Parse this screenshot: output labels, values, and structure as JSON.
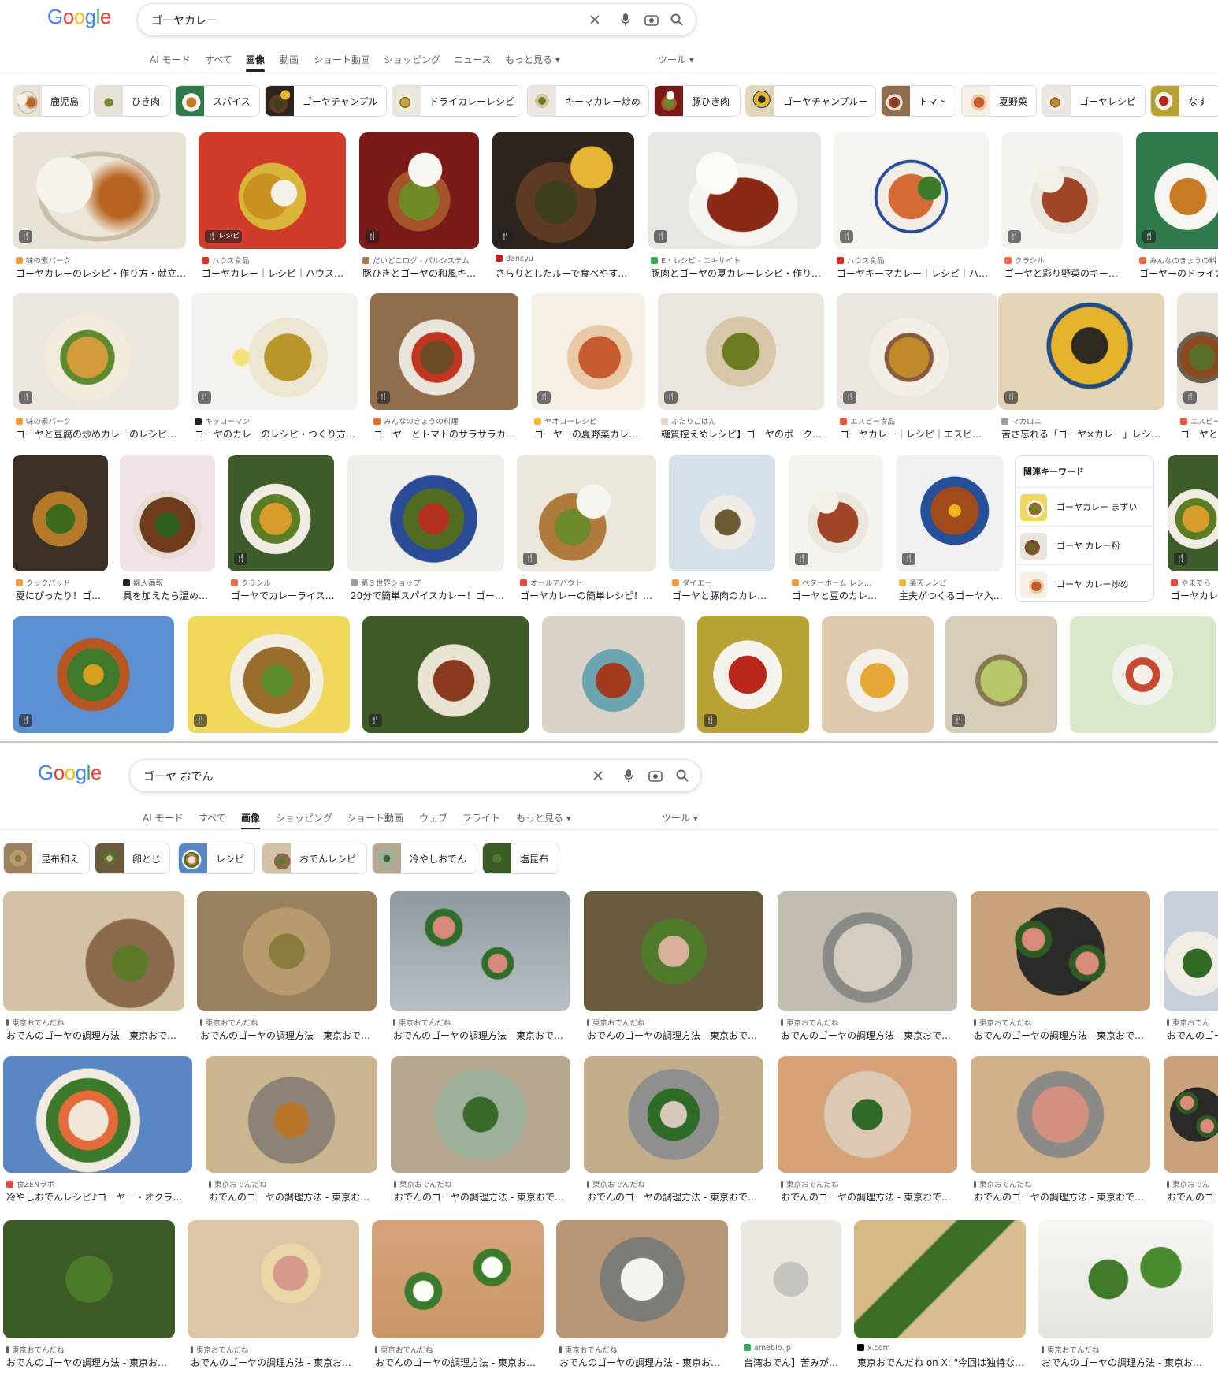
{
  "top": {
    "logo": "Google",
    "query": "ゴーヤカレー",
    "tabs": [
      "AI モード",
      "すべて",
      "画像",
      "動画",
      "ショート動画",
      "ショッピング",
      "ニュース",
      "もっと見る ▾"
    ],
    "active_tab": "画像",
    "tools": "ツール ▾",
    "chips": [
      "鹿児島",
      "ひき肉",
      "スパイス",
      "ゴーヤチャンプル",
      "ドライカレーレシピ",
      "キーマカレー炒め",
      "豚ひき肉",
      "ゴーヤチャンプルー",
      "トマト",
      "夏野菜",
      "ゴーヤレシピ",
      "なす"
    ],
    "row1": [
      {
        "source": "味の素パーク",
        "title": "ゴーヤカレーのレシピ・作り方・献立…",
        "badge": "🍴"
      },
      {
        "source": "ハウス食品",
        "title": "ゴーヤカレー｜レシピ｜ハウス…",
        "badge": "🍴 レシピ"
      },
      {
        "source": "だいどこログ - パルシステム",
        "title": "豚ひきとゴーヤの和風キ…",
        "badge": "🍴"
      },
      {
        "source": "dancyu",
        "title": "さらりとしたルーで食べやす…",
        "badge": "🍴"
      },
      {
        "source": "E・レシピ - エキサイト",
        "title": "豚肉とゴーヤの夏カレーレシピ・作り…",
        "badge": "🍴"
      },
      {
        "source": "ハウス食品",
        "title": "ゴーヤキーマカレー｜レシピ｜ハ…",
        "badge": "🍴"
      },
      {
        "source": "クラシル",
        "title": "ゴーヤと彩り野菜のキー…",
        "badge": "🍴"
      },
      {
        "source": "みんなのきょうの料",
        "title": "ゴーヤーのドライカ",
        "badge": "🍴"
      }
    ],
    "row2": [
      {
        "source": "味の素パーク",
        "title": "ゴーヤと豆腐の炒めカレーのレシピ…",
        "badge": "🍴"
      },
      {
        "source": "キッコーマン",
        "title": "ゴーヤのカレーのレシピ・つくり方…",
        "badge": "🍴"
      },
      {
        "source": "みんなのきょうの料理",
        "title": "ゴーヤーとトマトのサラサラカ…",
        "badge": "🍴"
      },
      {
        "source": "ヤオコーレシピ",
        "title": "ゴーヤーの夏野菜カレ…",
        "badge": "🍴"
      },
      {
        "source": "ふたりごはん",
        "title": "糖質控えめレシピ】ゴーヤのポーク…",
        "badge": "🍴"
      },
      {
        "source": "エスビー食品",
        "title": "ゴーヤカレー｜レシピ｜エスビ…",
        "badge": "🍴"
      },
      {
        "source": "マカロニ",
        "title": "苦さ忘れる「ゴーヤ×カレー」レシ…",
        "badge": "🍴"
      },
      {
        "source": "エスビー",
        "title": "ゴーヤと",
        "badge": "🍴"
      }
    ],
    "row3": [
      {
        "source": "クックパッド",
        "title": "夏にぴったり！ゴ…",
        "badge": ""
      },
      {
        "source": "婦人画報",
        "title": "具を加えたら温め…",
        "badge": ""
      },
      {
        "source": "クラシル",
        "title": "ゴーヤでカレーライス…",
        "badge": "🍴"
      },
      {
        "source": "第３世界ショップ",
        "title": "20分で簡単スパイスカレー！ゴー…",
        "badge": ""
      },
      {
        "source": "オールアバウト",
        "title": "ゴーヤカレーの簡単レシピ！…",
        "badge": "🍴"
      },
      {
        "source": "ダイエー",
        "title": "ゴーヤと豚肉のカレ…",
        "badge": ""
      },
      {
        "source": "ベターホーム レシ…",
        "title": "ゴーヤと豆のカレ…",
        "badge": "🍴"
      },
      {
        "source": "楽天レシピ",
        "title": "主夫がつくるゴーヤ入…",
        "badge": "🍴"
      },
      {
        "source": "やまでら",
        "title": "ゴーヤカレ",
        "badge": "🍴"
      }
    ],
    "related": {
      "header": "関連キーワード",
      "items": [
        "ゴーヤカレー まずい",
        "ゴーヤ カレー粉",
        "ゴーヤ カレー炒め"
      ]
    },
    "row4_badges": [
      "🍴",
      "🍴",
      "🍴",
      "",
      "🍴",
      "",
      "",
      "🍴",
      ""
    ]
  },
  "bottom": {
    "logo": "Google",
    "query": "ゴーヤ おでん",
    "tabs": [
      "AI モード",
      "すべて",
      "画像",
      "ショッピング",
      "ショート動画",
      "ウェブ",
      "フライト",
      "もっと見る ▾"
    ],
    "active_tab": "画像",
    "tools": "ツール ▾",
    "chips": [
      "昆布和え",
      "卵とじ",
      "レシピ",
      "おでんレシピ",
      "冷やしおでん",
      "塩昆布"
    ],
    "row1": [
      {
        "source": "東京おでんだね",
        "title": "おでんのゴーヤの調理方法 - 東京おで…"
      },
      {
        "source": "東京おでんだね",
        "title": "おでんのゴーヤの調理方法 - 東京おで…"
      },
      {
        "source": "東京おでんだね",
        "title": "おでんのゴーヤの調理方法 - 東京おで…"
      },
      {
        "source": "東京おでんだね",
        "title": "おでんのゴーヤの調理方法 - 東京おで…"
      },
      {
        "source": "東京おでんだね",
        "title": "おでんのゴーヤの調理方法 - 東京おで…"
      },
      {
        "source": "東京おでんだね",
        "title": "おでんのゴーヤの調理方法 - 東京おで…"
      },
      {
        "source": "東京おでん",
        "title": "おでんのゴー"
      }
    ],
    "row2": [
      {
        "source": "食ZENラボ",
        "title": "冷やしおでんレシピ♪ゴーヤー・オクラ…"
      },
      {
        "source": "東京おでんだね",
        "title": "おでんのゴーヤの調理方法 - 東京お…"
      },
      {
        "source": "東京おでんだね",
        "title": "おでんのゴーヤの調理方法 - 東京おで…"
      },
      {
        "source": "東京おでんだね",
        "title": "おでんのゴーヤの調理方法 - 東京おで…"
      },
      {
        "source": "東京おでんだね",
        "title": "おでんのゴーヤの調理方法 - 東京おで…"
      },
      {
        "source": "東京おでんだね",
        "title": "おでんのゴーヤの調理方法 - 東京おで…"
      },
      {
        "source": "東京おでん",
        "title": "おでんのゴー"
      }
    ],
    "row3": [
      {
        "source": "東京おでんだね",
        "title": "おでんのゴーヤの調理方法 - 東京お…"
      },
      {
        "source": "東京おでんだね",
        "title": "おでんのゴーヤの調理方法 - 東京お…"
      },
      {
        "source": "東京おでんだね",
        "title": "おでんのゴーヤの調理方法 - 東京お…"
      },
      {
        "source": "東京おでんだね",
        "title": "おでんのゴーヤの調理方法 - 東京お…"
      },
      {
        "source": "ameblo.jp",
        "title": "台湾おでん】苦みが…"
      },
      {
        "source": "x.com",
        "title": "東京おでんだね on X: \"今回は独特な…"
      },
      {
        "source": "東京おでんだね",
        "title": "おでんのゴーヤの調理方法 - 東京お…"
      }
    ]
  }
}
